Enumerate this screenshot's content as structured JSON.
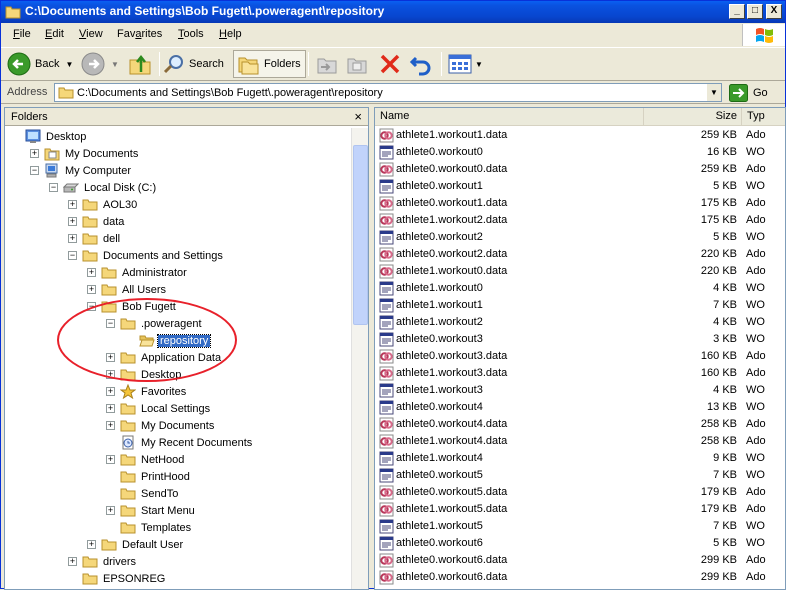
{
  "window": {
    "title": "C:\\Documents and Settings\\Bob Fugett\\.poweragent\\repository",
    "minimize": "_",
    "maximize": "□",
    "close": "X"
  },
  "menu": [
    "File",
    "Edit",
    "View",
    "Favorites",
    "Tools",
    "Help"
  ],
  "menu_mnemonics": [
    "F",
    "E",
    "V",
    "a",
    "T",
    "H"
  ],
  "toolbar": {
    "back_label": "Back",
    "search_label": "Search",
    "folders_label": "Folders"
  },
  "address": {
    "label": "Address",
    "value": "C:\\Documents and Settings\\Bob Fugett\\.poweragent\\repository",
    "go_label": "Go"
  },
  "folders_pane": {
    "title": "Folders",
    "close": "×",
    "tree": [
      {
        "label": "Desktop",
        "depth": 0,
        "expander": "",
        "icon": "desktop-icon"
      },
      {
        "label": "My Documents",
        "depth": 1,
        "expander": "+",
        "icon": "my-documents-icon"
      },
      {
        "label": "My Computer",
        "depth": 1,
        "expander": "-",
        "icon": "computer-icon"
      },
      {
        "label": "Local Disk (C:)",
        "depth": 2,
        "expander": "-",
        "icon": "drive-icon"
      },
      {
        "label": "AOL30",
        "depth": 3,
        "expander": "+",
        "icon": "folder-icon"
      },
      {
        "label": "data",
        "depth": 3,
        "expander": "+",
        "icon": "folder-icon"
      },
      {
        "label": "dell",
        "depth": 3,
        "expander": "+",
        "icon": "folder-icon"
      },
      {
        "label": "Documents and Settings",
        "depth": 3,
        "expander": "-",
        "icon": "folder-icon"
      },
      {
        "label": "Administrator",
        "depth": 4,
        "expander": "+",
        "icon": "folder-icon"
      },
      {
        "label": "All Users",
        "depth": 4,
        "expander": "+",
        "icon": "folder-icon"
      },
      {
        "label": "Bob Fugett",
        "depth": 4,
        "expander": "-",
        "icon": "folder-icon"
      },
      {
        "label": ".poweragent",
        "depth": 5,
        "expander": "-",
        "icon": "folder-icon"
      },
      {
        "label": "repository",
        "depth": 6,
        "expander": "",
        "icon": "folder-open-icon",
        "selected": true
      },
      {
        "label": "Application Data",
        "depth": 5,
        "expander": "+",
        "icon": "folder-icon"
      },
      {
        "label": "Desktop",
        "depth": 5,
        "expander": "+",
        "icon": "folder-icon"
      },
      {
        "label": "Favorites",
        "depth": 5,
        "expander": "+",
        "icon": "favorites-star-icon"
      },
      {
        "label": "Local Settings",
        "depth": 5,
        "expander": "+",
        "icon": "folder-icon"
      },
      {
        "label": "My Documents",
        "depth": 5,
        "expander": "+",
        "icon": "folder-icon"
      },
      {
        "label": "My Recent Documents",
        "depth": 5,
        "expander": "",
        "icon": "recent-documents-icon"
      },
      {
        "label": "NetHood",
        "depth": 5,
        "expander": "+",
        "icon": "folder-icon"
      },
      {
        "label": "PrintHood",
        "depth": 5,
        "expander": "",
        "icon": "folder-icon"
      },
      {
        "label": "SendTo",
        "depth": 5,
        "expander": "",
        "icon": "folder-icon"
      },
      {
        "label": "Start Menu",
        "depth": 5,
        "expander": "+",
        "icon": "folder-icon"
      },
      {
        "label": "Templates",
        "depth": 5,
        "expander": "",
        "icon": "folder-icon"
      },
      {
        "label": "Default User",
        "depth": 4,
        "expander": "+",
        "icon": "folder-icon"
      },
      {
        "label": "drivers",
        "depth": 3,
        "expander": "+",
        "icon": "folder-icon"
      },
      {
        "label": "EPSONREG",
        "depth": 3,
        "expander": "",
        "icon": "folder-icon"
      }
    ]
  },
  "file_list": {
    "columns": [
      "Name",
      "Size",
      "Typ"
    ],
    "rows": [
      {
        "name": "athlete1.workout1.data",
        "size": "259 KB",
        "type": "Ado",
        "kind": "data"
      },
      {
        "name": "athlete0.workout0",
        "size": "16 KB",
        "type": "WO",
        "kind": "wo"
      },
      {
        "name": "athlete0.workout0.data",
        "size": "259 KB",
        "type": "Ado",
        "kind": "data"
      },
      {
        "name": "athlete0.workout1",
        "size": "5 KB",
        "type": "WO",
        "kind": "wo"
      },
      {
        "name": "athlete0.workout1.data",
        "size": "175 KB",
        "type": "Ado",
        "kind": "data"
      },
      {
        "name": "athlete1.workout2.data",
        "size": "175 KB",
        "type": "Ado",
        "kind": "data"
      },
      {
        "name": "athlete0.workout2",
        "size": "5 KB",
        "type": "WO",
        "kind": "wo"
      },
      {
        "name": "athlete0.workout2.data",
        "size": "220 KB",
        "type": "Ado",
        "kind": "data"
      },
      {
        "name": "athlete1.workout0.data",
        "size": "220 KB",
        "type": "Ado",
        "kind": "data"
      },
      {
        "name": "athlete1.workout0",
        "size": "4 KB",
        "type": "WO",
        "kind": "wo"
      },
      {
        "name": "athlete1.workout1",
        "size": "7 KB",
        "type": "WO",
        "kind": "wo"
      },
      {
        "name": "athlete1.workout2",
        "size": "4 KB",
        "type": "WO",
        "kind": "wo"
      },
      {
        "name": "athlete0.workout3",
        "size": "3 KB",
        "type": "WO",
        "kind": "wo"
      },
      {
        "name": "athlete0.workout3.data",
        "size": "160 KB",
        "type": "Ado",
        "kind": "data"
      },
      {
        "name": "athlete1.workout3.data",
        "size": "160 KB",
        "type": "Ado",
        "kind": "data"
      },
      {
        "name": "athlete1.workout3",
        "size": "4 KB",
        "type": "WO",
        "kind": "wo"
      },
      {
        "name": "athlete0.workout4",
        "size": "13 KB",
        "type": "WO",
        "kind": "wo"
      },
      {
        "name": "athlete0.workout4.data",
        "size": "258 KB",
        "type": "Ado",
        "kind": "data"
      },
      {
        "name": "athlete1.workout4.data",
        "size": "258 KB",
        "type": "Ado",
        "kind": "data"
      },
      {
        "name": "athlete1.workout4",
        "size": "9 KB",
        "type": "WO",
        "kind": "wo"
      },
      {
        "name": "athlete0.workout5",
        "size": "7 KB",
        "type": "WO",
        "kind": "wo"
      },
      {
        "name": "athlete0.workout5.data",
        "size": "179 KB",
        "type": "Ado",
        "kind": "data"
      },
      {
        "name": "athlete1.workout5.data",
        "size": "179 KB",
        "type": "Ado",
        "kind": "data"
      },
      {
        "name": "athlete1.workout5",
        "size": "7 KB",
        "type": "WO",
        "kind": "wo"
      },
      {
        "name": "athlete0.workout6",
        "size": "5 KB",
        "type": "WO",
        "kind": "wo"
      },
      {
        "name": "athlete0.workout6.data",
        "size": "299 KB",
        "type": "Ado",
        "kind": "data"
      },
      {
        "name": "athlete0.workout6.data",
        "size": "299 KB",
        "type": "Ado",
        "kind": "data"
      }
    ]
  },
  "colors": {
    "titlebar": "#0A52E0",
    "selection": "#316AC5",
    "annotation_ellipse": "#E8202A",
    "chrome": "#ECE9D8"
  }
}
